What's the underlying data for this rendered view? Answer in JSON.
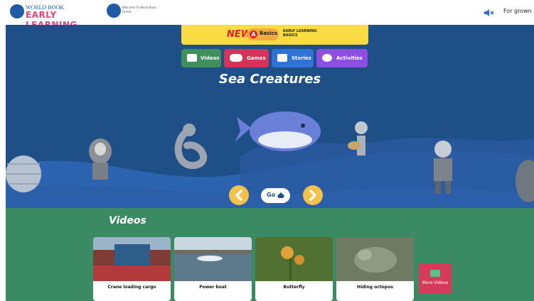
{
  "header": {
    "logo_line1": "WORLD BOOK",
    "logo_line2": "EARLY LEARNING",
    "welcome_line1": "Welcome To World Book",
    "welcome_line2": "Online",
    "grownups_label": "For grown ups"
  },
  "banner": {
    "new_label": "NEW",
    "basics_letter": "A",
    "basics_label": "Basics",
    "early_learning_label": "EARLY LEARNING BASICS"
  },
  "tabs": [
    {
      "label": "Videos",
      "color": "#3f8f5c",
      "icon": "video-icon"
    },
    {
      "label": "Games",
      "color": "#d6335a",
      "icon": "gamepad-icon"
    },
    {
      "label": "Stories",
      "color": "#2f73d6",
      "icon": "book-icon"
    },
    {
      "label": "Activities",
      "color": "#8c4fe0",
      "icon": "palette-icon"
    }
  ],
  "hero": {
    "title": "Sea Creatures",
    "go_label": "Go"
  },
  "videos": {
    "title": "Videos",
    "items": [
      {
        "caption": "Crane loading cargo"
      },
      {
        "caption": "Power boat"
      },
      {
        "caption": "Butterfly"
      },
      {
        "caption": "Hiding octopus"
      }
    ],
    "more_label": "More Videos"
  },
  "colors": {
    "hero_bg": "#1e4f86",
    "videos_bg": "#3a8a63",
    "banner_bg": "#f9dc43",
    "nav_arrow": "#f4c14a"
  }
}
